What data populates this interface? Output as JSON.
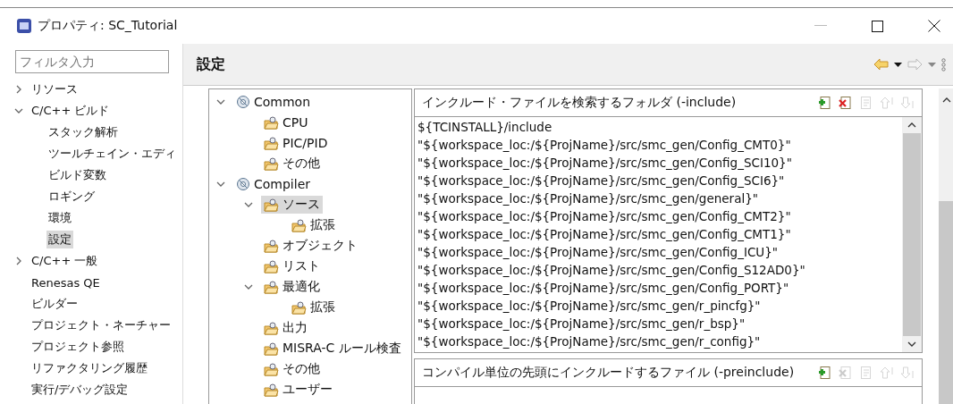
{
  "window": {
    "title": "プロパティ: SC_Tutorial"
  },
  "filter": {
    "placeholder": "フィルタ入力"
  },
  "sidebar": {
    "items": [
      {
        "label": "リソース",
        "expanded": false
      },
      {
        "label": "C/C++ ビルド",
        "expanded": true,
        "selected": false,
        "children": [
          {
            "label": "スタック解析",
            "selected": false
          },
          {
            "label": "ツールチェイン・エディ",
            "selected": false
          },
          {
            "label": "ビルド変数",
            "selected": false
          },
          {
            "label": "ロギング",
            "selected": false
          },
          {
            "label": "環境",
            "selected": false
          },
          {
            "label": "設定",
            "selected": true
          }
        ]
      },
      {
        "label": "C/C++ 一般",
        "expanded": false
      },
      {
        "label": "Renesas QE"
      },
      {
        "label": "ビルダー"
      },
      {
        "label": "プロジェクト・ネーチャー"
      },
      {
        "label": "プロジェクト参照"
      },
      {
        "label": "リファクタリング履歴"
      },
      {
        "label": "実行/デバッグ設定"
      }
    ]
  },
  "page": {
    "title": "設定"
  },
  "tool_tree": [
    {
      "label": "Common",
      "kind": "tool",
      "expanded": true,
      "selected": false,
      "children": [
        {
          "label": "CPU",
          "kind": "folder",
          "selected": false
        },
        {
          "label": "PIC/PID",
          "kind": "folder",
          "selected": false
        },
        {
          "label": "その他",
          "kind": "folder",
          "selected": false
        }
      ]
    },
    {
      "label": "Compiler",
      "kind": "tool",
      "expanded": true,
      "selected": false,
      "children": [
        {
          "label": "ソース",
          "kind": "folder",
          "expanded": true,
          "selected": true,
          "children": [
            {
              "label": "拡張",
              "kind": "folder",
              "selected": false
            }
          ]
        },
        {
          "label": "オブジェクト",
          "kind": "folder",
          "selected": false
        },
        {
          "label": "リスト",
          "kind": "folder",
          "selected": false
        },
        {
          "label": "最適化",
          "kind": "folder",
          "expanded": true,
          "selected": false,
          "children": [
            {
              "label": "拡張",
              "kind": "folder",
              "selected": false
            }
          ]
        },
        {
          "label": "出力",
          "kind": "folder",
          "selected": false
        },
        {
          "label": "MISRA-C ルール検査",
          "kind": "folder",
          "selected": false
        },
        {
          "label": "その他",
          "kind": "folder",
          "selected": false
        },
        {
          "label": "ユーザー",
          "kind": "folder",
          "selected": false
        }
      ]
    }
  ],
  "include_panel": {
    "title": "インクルード・ファイルを検索するフォルダ (-include)",
    "tools": [
      {
        "kind": "add",
        "disabled": false
      },
      {
        "kind": "delete",
        "disabled": false
      },
      {
        "kind": "edit",
        "disabled": true
      },
      {
        "kind": "up",
        "disabled": true
      },
      {
        "kind": "down",
        "disabled": true
      }
    ],
    "items": [
      "${TCINSTALL}/include",
      "\"${workspace_loc:/${ProjName}/src/smc_gen/Config_CMT0}\"",
      "\"${workspace_loc:/${ProjName}/src/smc_gen/Config_SCI10}\"",
      "\"${workspace_loc:/${ProjName}/src/smc_gen/Config_SCI6}\"",
      "\"${workspace_loc:/${ProjName}/src/smc_gen/general}\"",
      "\"${workspace_loc:/${ProjName}/src/smc_gen/Config_CMT2}\"",
      "\"${workspace_loc:/${ProjName}/src/smc_gen/Config_CMT1}\"",
      "\"${workspace_loc:/${ProjName}/src/smc_gen/Config_ICU}\"",
      "\"${workspace_loc:/${ProjName}/src/smc_gen/Config_S12AD0}\"",
      "\"${workspace_loc:/${ProjName}/src/smc_gen/Config_PORT}\"",
      "\"${workspace_loc:/${ProjName}/src/smc_gen/r_pincfg}\"",
      "\"${workspace_loc:/${ProjName}/src/smc_gen/r_bsp}\"",
      "\"${workspace_loc:/${ProjName}/src/smc_gen/r_config}\""
    ]
  },
  "preinclude_panel": {
    "title": "コンパイル単位の先頭にインクルードするファイル (-preinclude)",
    "tools": [
      {
        "kind": "add",
        "disabled": false
      },
      {
        "kind": "delete",
        "disabled": true
      },
      {
        "kind": "edit",
        "disabled": true
      },
      {
        "kind": "up",
        "disabled": true
      },
      {
        "kind": "down",
        "disabled": true
      }
    ]
  }
}
